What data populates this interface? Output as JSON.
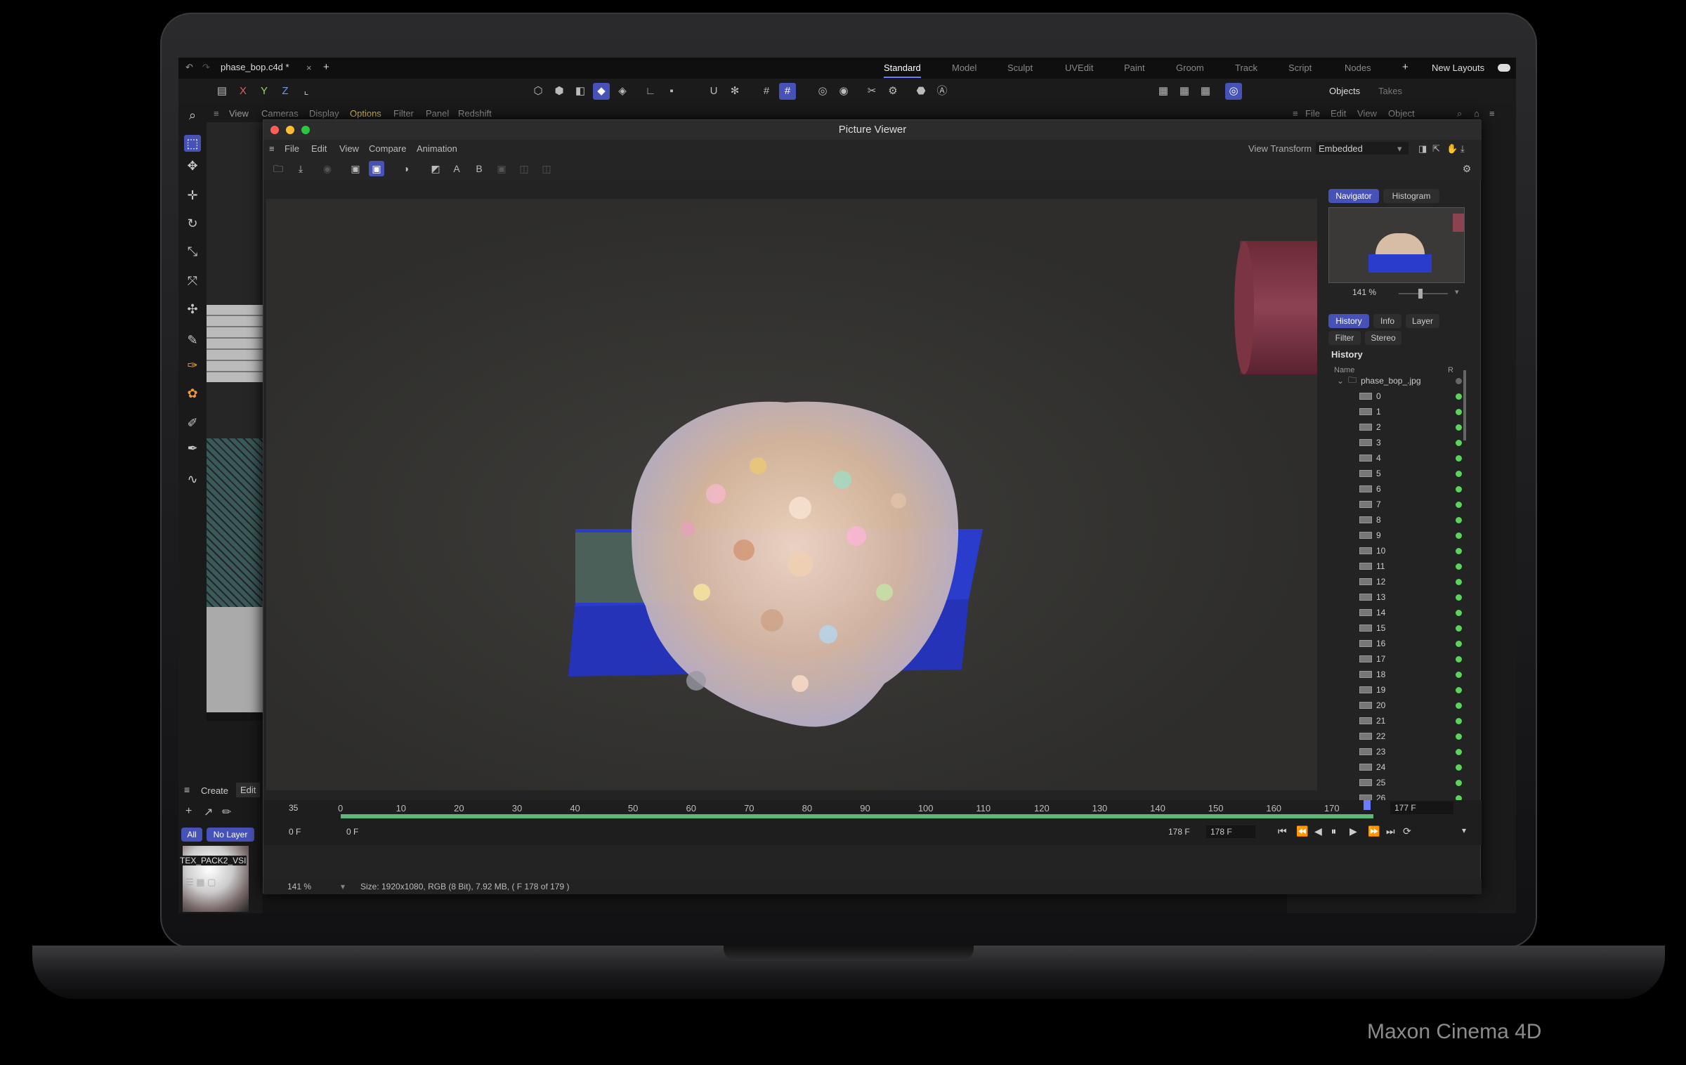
{
  "topbar": {
    "file_tab": "phase_bop.c4d *",
    "layouts": [
      "Standard",
      "Model",
      "Sculpt",
      "UVEdit",
      "Paint",
      "Groom",
      "Track",
      "Script",
      "Nodes"
    ],
    "new_layouts": "New Layouts"
  },
  "toolbar": {
    "axes": [
      "X",
      "Y",
      "Z"
    ]
  },
  "menubar": {
    "items": [
      "View",
      "Cameras",
      "Display",
      "Options",
      "Filter",
      "Panel",
      "Redshift"
    ]
  },
  "objects_panel": {
    "tabs": [
      "Objects",
      "Takes"
    ],
    "menu": [
      "File",
      "Edit",
      "View",
      "Object"
    ]
  },
  "picture_viewer": {
    "title": "Picture Viewer",
    "menu": [
      "File",
      "Edit",
      "View",
      "Compare",
      "Animation"
    ],
    "view_transform_label": "View Transform",
    "view_transform_value": "Embedded",
    "compare_a": "A",
    "compare_b": "B",
    "side_tabs": [
      "Navigator",
      "Histogram"
    ],
    "zoom": "141 %",
    "history_tabs": [
      "History",
      "Info",
      "Layer",
      "Filter",
      "Stereo"
    ],
    "history_heading": "History",
    "col_name": "Name",
    "col_r": "R",
    "folder": "phase_bop_.jpg",
    "frames": [
      "0",
      "1",
      "2",
      "3",
      "4",
      "5",
      "6",
      "7",
      "8",
      "9",
      "10",
      "11",
      "12",
      "13",
      "14",
      "15",
      "16",
      "17",
      "18",
      "19",
      "20",
      "21",
      "22",
      "23",
      "24",
      "25",
      "26"
    ]
  },
  "timeline": {
    "current_frame": "35",
    "ticks": [
      "0",
      "10",
      "20",
      "30",
      "40",
      "50",
      "60",
      "70",
      "80",
      "90",
      "100",
      "110",
      "120",
      "130",
      "140",
      "150",
      "160",
      "170"
    ],
    "start_a": "0 F",
    "start_b": "0 F",
    "end_a": "178 F",
    "end_b": "178 F",
    "frame_right": "177 F"
  },
  "status": {
    "zoom": "141 %",
    "info": "Size: 1920x1080, RGB (8 Bit), 7.92 MB,  ( F 178 of 179 )"
  },
  "bottom_left": {
    "tabs": [
      "Create",
      "Edit"
    ],
    "filters": [
      "All",
      "No Layer"
    ],
    "material": "TEX_PACK2_VSI"
  },
  "caption": "Maxon Cinema 4D",
  "colors": {
    "accent": "#4752b8",
    "ok": "#5ad45a"
  }
}
